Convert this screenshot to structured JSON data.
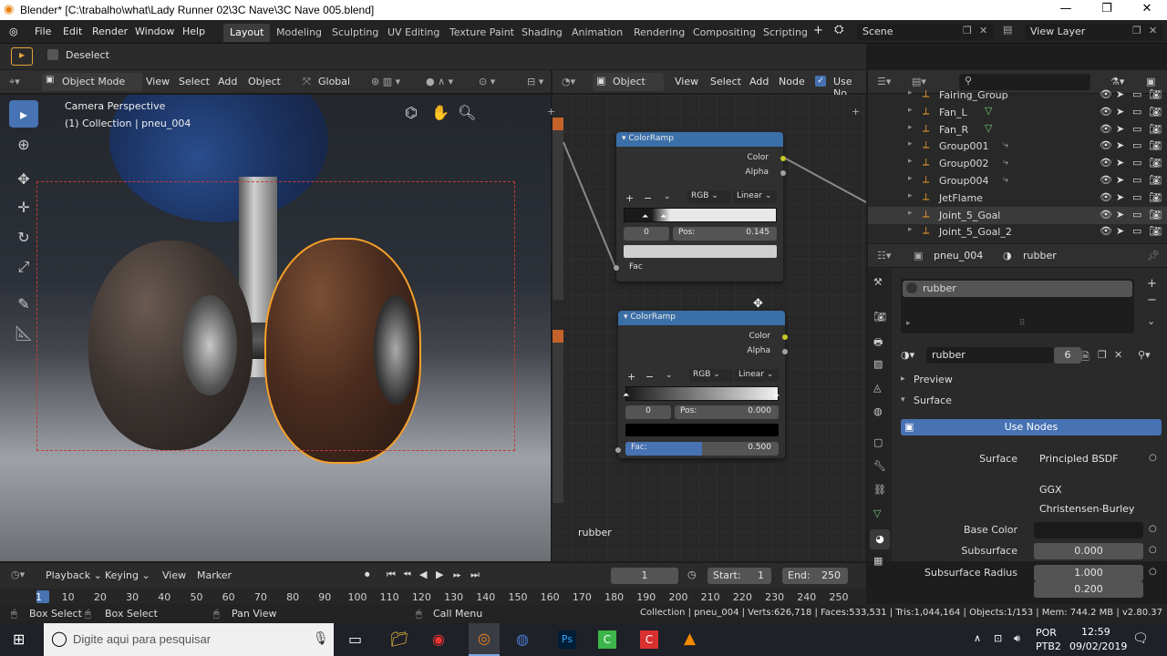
{
  "window": {
    "title": "Blender* [C:\\trabalho\\what\\Lady Runner 02\\3C Nave\\3C Nave 005.blend]",
    "minimize": "—",
    "maximize": "❐",
    "close": "✕"
  },
  "menus": [
    "File",
    "Edit",
    "Render",
    "Window",
    "Help"
  ],
  "workspaces": [
    "Layout",
    "Modeling",
    "Sculpting",
    "UV Editing",
    "Texture Paint",
    "Shading",
    "Animation",
    "Rendering",
    "Compositing",
    "Scripting"
  ],
  "scene": {
    "label": "Scene",
    "view_layer": "View Layer",
    "add": "+"
  },
  "toolbar_top": {
    "deselect": "Deselect"
  },
  "viewport": {
    "mode": "Object Mode",
    "view": "View",
    "select": "Select",
    "add": "Add",
    "object": "Object",
    "transform": "Global",
    "camera_label": "Camera Perspective",
    "collection_label": "(1) Collection | pneu_004"
  },
  "node_editor": {
    "type": "Object",
    "view": "View",
    "select": "Select",
    "add": "Add",
    "node": "Node",
    "use_nodes": "Use No",
    "material_name": "rubber",
    "nodes": [
      {
        "title": "ColorRamp",
        "out_color": "Color",
        "out_alpha": "Alpha",
        "plus": "+",
        "minus": "−",
        "mode": "RGB",
        "interp": "Linear",
        "stop_index": "0",
        "pos_label": "Pos:",
        "pos_value": "0.145",
        "fac_label": "Fac",
        "fac_value": ""
      },
      {
        "title": "ColorRamp",
        "out_color": "Color",
        "out_alpha": "Alpha",
        "plus": "+",
        "minus": "−",
        "mode": "RGB",
        "interp": "Linear",
        "stop_index": "0",
        "pos_label": "Pos:",
        "pos_value": "0.000",
        "fac_label": "Fac:",
        "fac_value": "0.500"
      }
    ]
  },
  "outliner": {
    "rows": [
      "Fairing_Group",
      "Fan_L",
      "Fan_R",
      "Group001",
      "Group002",
      "Group004",
      "JetFlame",
      "Joint_5_Goal",
      "Joint_5_Goal_2"
    ]
  },
  "properties": {
    "object": "pneu_004",
    "material": "rubber",
    "slot": "rubber",
    "users": "6",
    "preview": "Preview",
    "surface": "Surface",
    "use_nodes": "Use Nodes",
    "rows": [
      {
        "label": "Surface",
        "value": "Principled BSDF"
      },
      {
        "label": "",
        "value": "GGX"
      },
      {
        "label": "",
        "value": "Christensen-Burley"
      },
      {
        "label": "Base Color",
        "value": ""
      },
      {
        "label": "Subsurface",
        "value": "0.000"
      },
      {
        "label": "Subsurface Radius",
        "value": "1.000"
      },
      {
        "label": "",
        "value": "0.200"
      }
    ]
  },
  "timeline": {
    "playback": "Playback",
    "keying": "Keying",
    "view": "View",
    "marker": "Marker",
    "current": "1",
    "start_label": "Start:",
    "start": "1",
    "end_label": "End:",
    "end": "250",
    "ticks": [
      "1",
      "10",
      "20",
      "30",
      "40",
      "50",
      "60",
      "70",
      "80",
      "90",
      "100",
      "110",
      "120",
      "130",
      "140",
      "150",
      "160",
      "170",
      "180",
      "190",
      "200",
      "210",
      "220",
      "230",
      "240",
      "250"
    ]
  },
  "statusbar": {
    "box_select": "Box Select",
    "box_select2": "Box Select",
    "pan_view": "Pan View",
    "call_menu": "Call Menu",
    "stats": "Collection | pneu_004 | Verts:626,718 | Faces:533,531 | Tris:1,044,164 | Objects:1/153 | Mem: 744.2 MB | v2.80.37"
  },
  "taskbar": {
    "search": "Digite aqui para pesquisar",
    "lang": "POR",
    "kb": "PTB2",
    "time": "12:59",
    "date": "09/02/2019"
  },
  "colors": {
    "accent": "#4772b3",
    "node_header": "#3b6fa8",
    "selection": "#f5a02c"
  }
}
